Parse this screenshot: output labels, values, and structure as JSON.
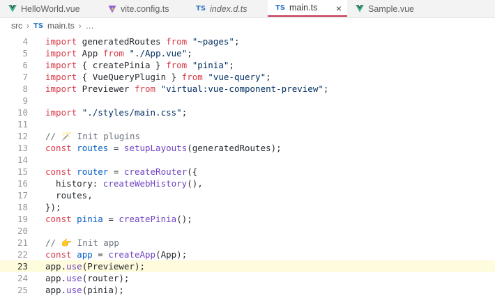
{
  "tabs": [
    {
      "label": "HelloWorld.vue",
      "type": "vue"
    },
    {
      "label": "vite.config.ts",
      "type": "vite"
    },
    {
      "label": "index.d.ts",
      "type": "ts"
    },
    {
      "label": "main.ts",
      "type": "ts",
      "active": true,
      "close": "×"
    },
    {
      "label": "Sample.vue",
      "type": "vue"
    }
  ],
  "badge_ts": "TS",
  "breadcrumb": {
    "folder": "src",
    "file": "main.ts",
    "more": "…"
  },
  "colors": {
    "vue": "#41b883",
    "vite": "#8a63d2",
    "ts": "#3178c6",
    "active_underline": "#c4314b",
    "current_line": "#fffbdd"
  },
  "lines": [
    {
      "num": "4",
      "tokens": [
        [
          "kw",
          "import"
        ],
        [
          "pc",
          " generatedRoutes "
        ],
        [
          "kw",
          "from"
        ],
        [
          "pc",
          " "
        ],
        [
          "str",
          "\"~pages\""
        ],
        [
          "pc",
          ";"
        ]
      ]
    },
    {
      "num": "5",
      "tokens": [
        [
          "kw",
          "import"
        ],
        [
          "pc",
          " App "
        ],
        [
          "kw",
          "from"
        ],
        [
          "pc",
          " "
        ],
        [
          "str",
          "\"./App.vue\""
        ],
        [
          "pc",
          ";"
        ]
      ]
    },
    {
      "num": "6",
      "tokens": [
        [
          "kw",
          "import"
        ],
        [
          "pc",
          " { createPinia } "
        ],
        [
          "kw",
          "from"
        ],
        [
          "pc",
          " "
        ],
        [
          "str",
          "\"pinia\""
        ],
        [
          "pc",
          ";"
        ]
      ]
    },
    {
      "num": "7",
      "tokens": [
        [
          "kw",
          "import"
        ],
        [
          "pc",
          " { VueQueryPlugin } "
        ],
        [
          "kw",
          "from"
        ],
        [
          "pc",
          " "
        ],
        [
          "str",
          "\"vue-query\""
        ],
        [
          "pc",
          ";"
        ]
      ]
    },
    {
      "num": "8",
      "tokens": [
        [
          "kw",
          "import"
        ],
        [
          "pc",
          " Previewer "
        ],
        [
          "kw",
          "from"
        ],
        [
          "pc",
          " "
        ],
        [
          "str",
          "\"virtual:vue-component-preview\""
        ],
        [
          "pc",
          ";"
        ]
      ]
    },
    {
      "num": "9",
      "tokens": []
    },
    {
      "num": "10",
      "tokens": [
        [
          "kw",
          "import"
        ],
        [
          "pc",
          " "
        ],
        [
          "str",
          "\"./styles/main.css\""
        ],
        [
          "pc",
          ";"
        ]
      ]
    },
    {
      "num": "11",
      "tokens": []
    },
    {
      "num": "12",
      "tokens": [
        [
          "cm",
          "// "
        ],
        [
          "emoji",
          "🪄"
        ],
        [
          "cm",
          " Init plugins"
        ]
      ]
    },
    {
      "num": "13",
      "tokens": [
        [
          "kw",
          "const"
        ],
        [
          "pc",
          " "
        ],
        [
          "var",
          "routes"
        ],
        [
          "pc",
          " = "
        ],
        [
          "fn",
          "setupLayouts"
        ],
        [
          "pc",
          "(generatedRoutes);"
        ]
      ]
    },
    {
      "num": "14",
      "tokens": []
    },
    {
      "num": "15",
      "tokens": [
        [
          "kw",
          "const"
        ],
        [
          "pc",
          " "
        ],
        [
          "var",
          "router"
        ],
        [
          "pc",
          " = "
        ],
        [
          "fn",
          "createRouter"
        ],
        [
          "pc",
          "({"
        ]
      ]
    },
    {
      "num": "16",
      "tokens": [
        [
          "pc",
          "  history: "
        ],
        [
          "fn",
          "createWebHistory"
        ],
        [
          "pc",
          "(),"
        ]
      ]
    },
    {
      "num": "17",
      "tokens": [
        [
          "pc",
          "  routes,"
        ]
      ]
    },
    {
      "num": "18",
      "tokens": [
        [
          "pc",
          "});"
        ]
      ]
    },
    {
      "num": "19",
      "tokens": [
        [
          "kw",
          "const"
        ],
        [
          "pc",
          " "
        ],
        [
          "var",
          "pinia"
        ],
        [
          "pc",
          " = "
        ],
        [
          "fn",
          "createPinia"
        ],
        [
          "pc",
          "();"
        ]
      ]
    },
    {
      "num": "20",
      "tokens": []
    },
    {
      "num": "21",
      "tokens": [
        [
          "cm",
          "// "
        ],
        [
          "emoji",
          "👉"
        ],
        [
          "cm",
          " Init app"
        ]
      ]
    },
    {
      "num": "22",
      "tokens": [
        [
          "kw",
          "const"
        ],
        [
          "pc",
          " "
        ],
        [
          "var",
          "app"
        ],
        [
          "pc",
          " = "
        ],
        [
          "fn",
          "createApp"
        ],
        [
          "pc",
          "(App);"
        ]
      ]
    },
    {
      "num": "23",
      "current": true,
      "tokens": [
        [
          "pc",
          "app."
        ],
        [
          "fn",
          "use"
        ],
        [
          "pc",
          "(Previewer);"
        ]
      ]
    },
    {
      "num": "24",
      "tokens": [
        [
          "pc",
          "app."
        ],
        [
          "fn",
          "use"
        ],
        [
          "pc",
          "(router);"
        ]
      ]
    },
    {
      "num": "25",
      "tokens": [
        [
          "pc",
          "app."
        ],
        [
          "fn",
          "use"
        ],
        [
          "pc",
          "(pinia);"
        ]
      ]
    }
  ]
}
